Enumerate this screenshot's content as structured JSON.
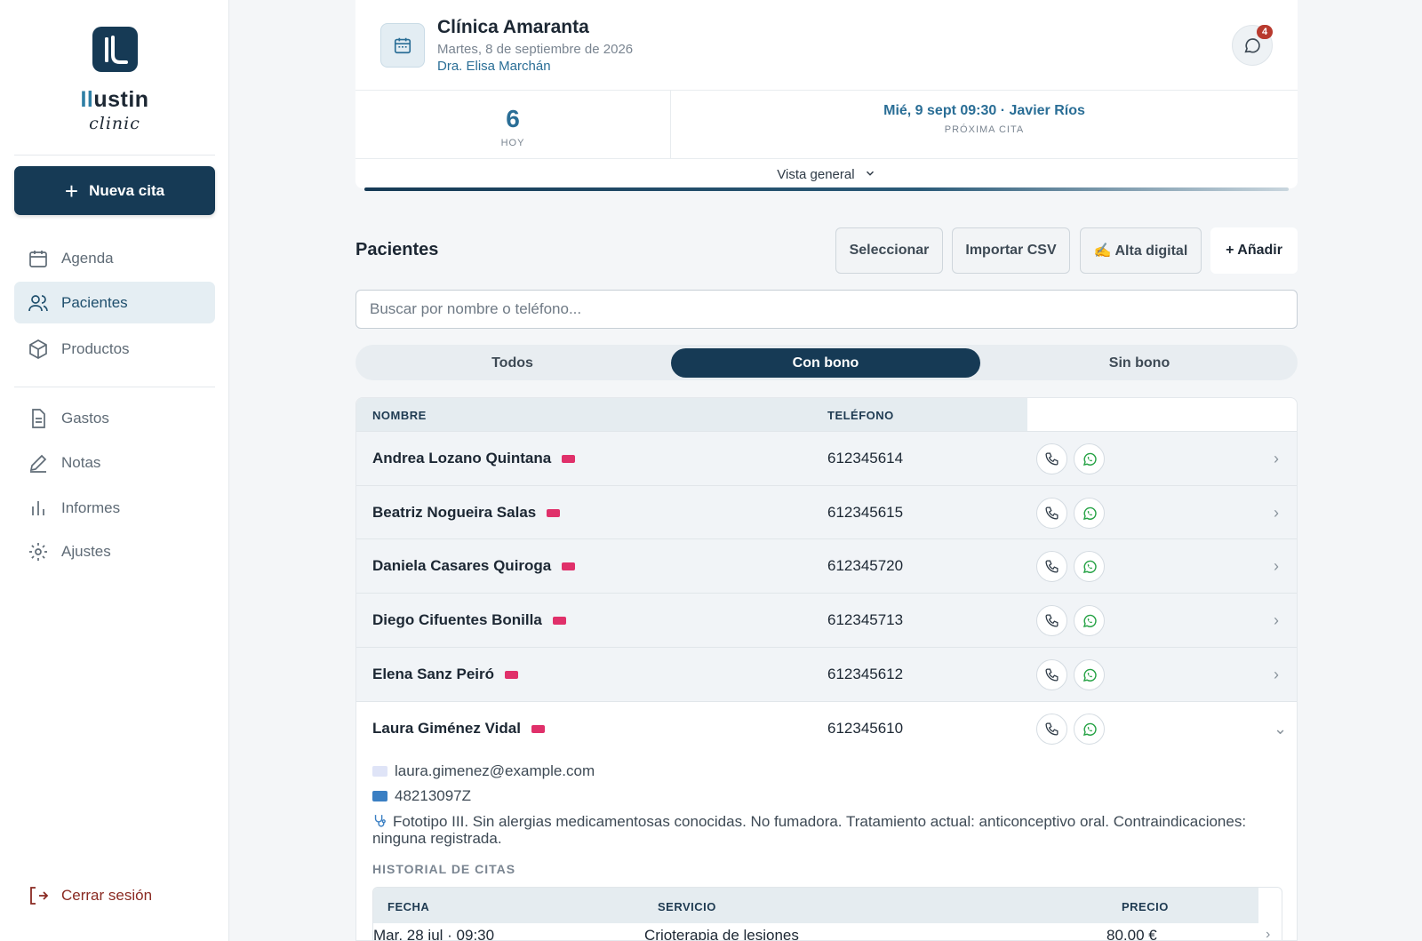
{
  "brand": {
    "name_accent": "Il",
    "name_rest": "ustin",
    "sub": "clinic"
  },
  "sidebar": {
    "new_appt_label": "Nueva cita",
    "items": [
      {
        "label": "Agenda",
        "icon": "calendar-icon"
      },
      {
        "label": "Pacientes",
        "icon": "users-icon",
        "active": true
      },
      {
        "label": "Productos",
        "icon": "box-icon"
      },
      {
        "label": "Gastos",
        "icon": "document-icon"
      },
      {
        "label": "Notas",
        "icon": "pen-icon"
      },
      {
        "label": "Informes",
        "icon": "bar-chart-icon"
      },
      {
        "label": "Ajustes",
        "icon": "gear-icon"
      }
    ],
    "logout_label": "Cerrar sesión"
  },
  "header": {
    "clinic_name": "Clínica Amaranta",
    "date": "Martes, 8 de septiembre de 2026",
    "doctor": "Dra. Elisa Marchán",
    "chat_badge": "4",
    "today_count": "6",
    "today_label": "HOY",
    "next_appt": "Mié, 9 sept 09:30 · Javier Ríos",
    "next_label": "PRÓXIMA CITA",
    "overview_label": "Vista general"
  },
  "patients": {
    "title": "Pacientes",
    "buttons": {
      "select": "Seleccionar",
      "import": "Importar CSV",
      "digital": "✍️ Alta digital",
      "add": "+ Añadir"
    },
    "search_placeholder": "Buscar por nombre o teléfono...",
    "filters": [
      "Todos",
      "Con bono",
      "Sin bono"
    ],
    "active_filter": "Con bono",
    "columns": {
      "name": "NOMBRE",
      "phone": "TELÉFONO"
    },
    "rows": [
      {
        "name": "Andrea Lozano Quintana",
        "phone": "612345614"
      },
      {
        "name": "Beatriz Nogueira Salas",
        "phone": "612345615"
      },
      {
        "name": "Daniela Casares Quiroga",
        "phone": "612345720"
      },
      {
        "name": "Diego Cifuentes Bonilla",
        "phone": "612345713"
      },
      {
        "name": "Elena Sanz Peiró",
        "phone": "612345612"
      },
      {
        "name": "Laura Giménez Vidal",
        "phone": "612345610"
      }
    ],
    "expanded": {
      "email": "laura.gimenez@example.com",
      "dni": "48213097Z",
      "notes": "Fototipo III. Sin alergias medicamentosas conocidas. No fumadora. Tratamiento actual: anticonceptivo oral. Contraindicaciones: ninguna registrada.",
      "history_title": "HISTORIAL DE CITAS",
      "history_columns": {
        "date": "FECHA",
        "service": "SERVICIO",
        "price": "PRECIO"
      },
      "history": [
        {
          "date": "Mar, 28 jul · 09:30",
          "service": "Crioterapia de lesiones",
          "price": "80,00 €"
        }
      ]
    }
  },
  "colors": {
    "primary": "#163a55",
    "accent": "#2a6e96",
    "bono": "#e0306a",
    "danger": "#8a2a22",
    "whatsapp": "#25a244"
  }
}
